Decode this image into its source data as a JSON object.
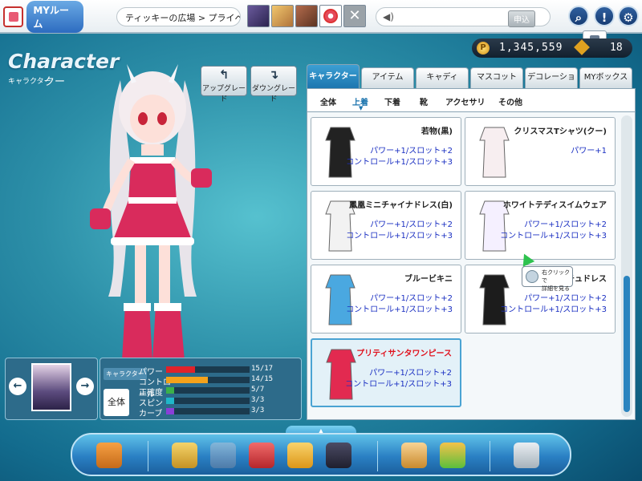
{
  "topbar": {
    "logo_text": "MYルーム",
    "breadcrumb": "ティッキーの広場 > プライベート",
    "chat_button": "申込"
  },
  "currency": {
    "money": "1,345,559",
    "gems": "18"
  },
  "character": {
    "title": "Character",
    "label": "キャラクター",
    "name": "クー"
  },
  "buttons": {
    "upgrade": "アップグレード",
    "downgrade": "ダウングレード"
  },
  "stats": {
    "panel_label": "キャラクター",
    "all_button": "全体",
    "rows": [
      {
        "name": "パワー",
        "value": "15/17",
        "fill": 0.35,
        "color": "#e0222a"
      },
      {
        "name": "コントロール",
        "value": "14/15",
        "fill": 0.5,
        "color": "#f4a21b"
      },
      {
        "name": "正確度",
        "value": "5/7",
        "fill": 0.1,
        "color": "#3bb14a"
      },
      {
        "name": "スピン",
        "value": "3/3",
        "fill": 0.1,
        "color": "#1fb7c9"
      },
      {
        "name": "カーブ",
        "value": "3/3",
        "fill": 0.1,
        "color": "#8a3fd8"
      }
    ]
  },
  "tabs": [
    "キャラクター",
    "アイテム",
    "キャディ",
    "マスコット",
    "デコレーション",
    "MYボックス"
  ],
  "filters": [
    "全体",
    "上着",
    "下着",
    "靴",
    "アクセサリ",
    "その他"
  ],
  "items": [
    {
      "name": "若物(黒)",
      "lines": [
        "パワー+1/スロット+2",
        "コントロール+1/スロット+3"
      ],
      "red": false
    },
    {
      "name": "クリスマスTシャツ(クー)",
      "lines": [
        "パワー+1"
      ],
      "red": false
    },
    {
      "name": "鳳凰ミニチャイナドレス(白)",
      "lines": [
        "パワー+1/スロット+2",
        "コントロール+1/スロット+3"
      ],
      "red": false
    },
    {
      "name": "ホワイトテディスイムウェア",
      "lines": [
        "パワー+1/スロット+2",
        "コントロール+1/スロット+3"
      ],
      "red": false
    },
    {
      "name": "ブルービキニ",
      "lines": [
        "パワー+1/スロット+2",
        "コントロール+1/スロット+3"
      ],
      "red": false
    },
    {
      "name": "スチュドレス",
      "lines": [
        "パワー+1/スロット+2",
        "コントロール+1/スロット+3"
      ],
      "red": false
    },
    {
      "name": "プリティサンタワンピース",
      "lines": [
        "パワー+1/スロット+2",
        "コントロール+1/スロット+3"
      ],
      "red": true
    }
  ],
  "tooltip": {
    "line1": "右クリックで",
    "line2": "詳細を見る"
  }
}
